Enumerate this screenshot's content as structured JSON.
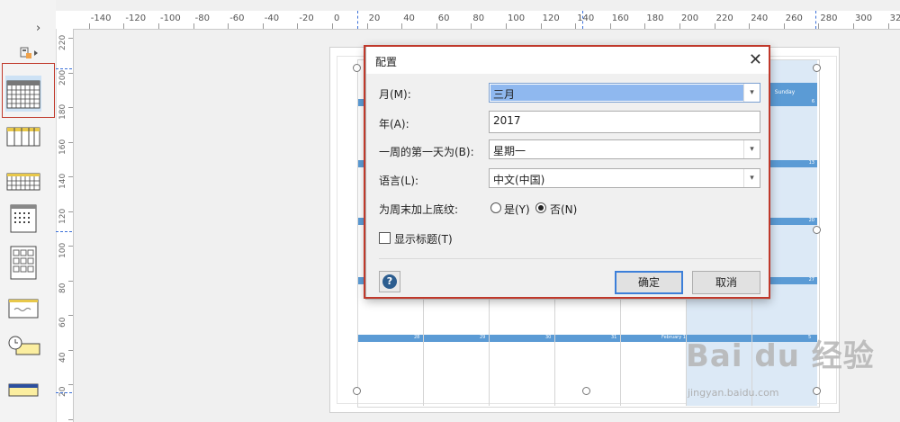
{
  "stencil": {
    "expand_glyph": "›",
    "shapes": [
      {
        "name": "monthly-calendar-shape",
        "selected": true
      },
      {
        "name": "weekly-calendar-shape",
        "selected": false
      },
      {
        "name": "multi-week-calendar-shape",
        "selected": false
      },
      {
        "name": "day-calendar-shape",
        "selected": false
      },
      {
        "name": "yearly-calendar-shape",
        "selected": false
      },
      {
        "name": "appointment-shape",
        "selected": false
      },
      {
        "name": "timeline-shape",
        "selected": false
      },
      {
        "name": "event-bar-shape",
        "selected": false
      }
    ]
  },
  "hruler": {
    "labels": [
      "-140",
      "-120",
      "-100",
      "-80",
      "-60",
      "-40",
      "-20",
      "0",
      "20",
      "40",
      "60",
      "80",
      "100",
      "120",
      "140",
      "160",
      "180",
      "200",
      "220",
      "240",
      "260",
      "280",
      "300",
      "320"
    ]
  },
  "vruler": {
    "labels": [
      "220",
      "200",
      "180",
      "160",
      "140",
      "120",
      "100",
      "80",
      "60",
      "40",
      "20",
      "0"
    ]
  },
  "calendar": {
    "sunday_header": "Sunday",
    "band_dates": [
      {
        "left": "",
        "right": "6"
      },
      {
        "left": "",
        "right": "13"
      },
      {
        "left": "",
        "right": "20"
      },
      {
        "left": "",
        "right": "27"
      }
    ],
    "last_band": [
      "28",
      "29",
      "30",
      "31",
      "February 1",
      "",
      "5"
    ]
  },
  "watermark": {
    "logo": "Bai du 经验",
    "url": "jingyan.baidu.com"
  },
  "dialog": {
    "title": "配置",
    "month": {
      "label": "月(M):",
      "value": "三月"
    },
    "year": {
      "label": "年(A):",
      "value": "2017"
    },
    "first_day": {
      "label": "一周的第一天为(B):",
      "value": "星期一"
    },
    "language": {
      "label": "语言(L):",
      "value": "中文(中国)"
    },
    "shade_weekends": {
      "label": "为周末加上底纹:",
      "yes": "是(Y)",
      "no": "否(N)",
      "selected": "no"
    },
    "show_title": {
      "label": "显示标题(T)",
      "checked": false
    },
    "ok_label": "确定",
    "cancel_label": "取消",
    "help_glyph": "?",
    "close_glyph": "✕",
    "dropdown_glyph": "▾"
  }
}
